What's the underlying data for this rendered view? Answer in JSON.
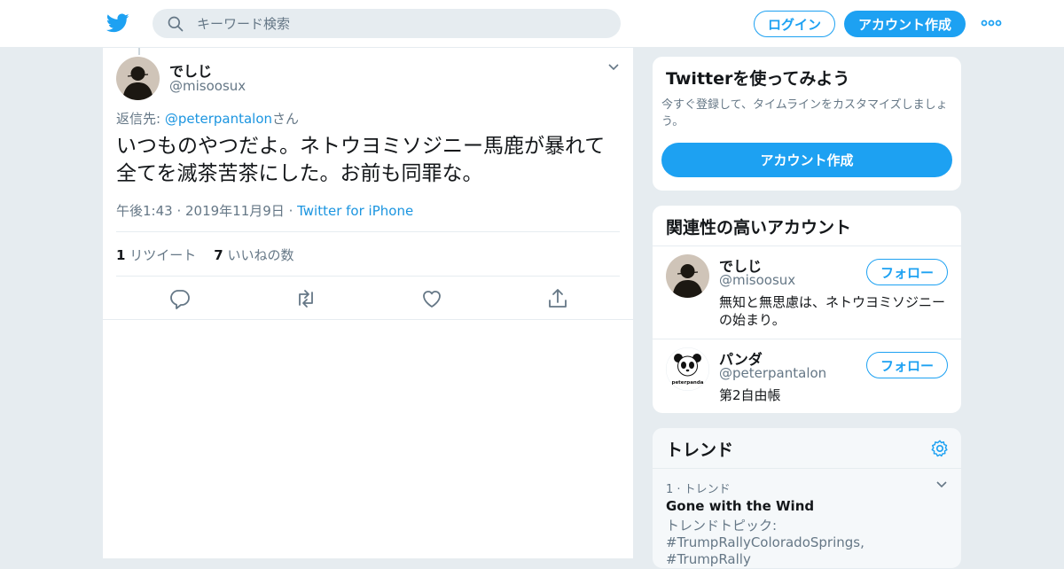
{
  "header": {
    "search_placeholder": "キーワード検索",
    "login_label": "ログイン",
    "signup_label": "アカウント作成",
    "brand_color": "#1da1f2"
  },
  "tweet": {
    "author_name": "でしじ",
    "author_handle": "@misoosux",
    "reply_prefix": "返信先: ",
    "reply_mention": "@peterpantalon",
    "reply_suffix": "さん",
    "text": "いつものやつだよ。ネトウヨミソジニー馬鹿が暴れて全てを滅茶苦茶にした。お前も同罪な。",
    "time": "午後1:43 · 2019年11月9日",
    "source_separator": " · ",
    "source": "Twitter for iPhone",
    "retweet_count": "1",
    "retweet_label": "リツイート",
    "like_count": "7",
    "like_label": "いいねの数"
  },
  "sidebar": {
    "signup_card": {
      "title": "Twitterを使ってみよう",
      "description": "今すぐ登録して、タイムラインをカスタマイズしましょう。",
      "button_label": "アカウント作成"
    },
    "related": {
      "title": "関連性の高いアカウント",
      "follow_label": "フォロー",
      "accounts": [
        {
          "name": "でしじ",
          "handle": "@misoosux",
          "bio": "無知と無思慮は、ネトウヨミソジニーの始まり。"
        },
        {
          "name": "パンダ",
          "handle": "@peterpantalon",
          "bio": "第2自由帳",
          "avatar_text": "peterpanda"
        }
      ]
    },
    "trends": {
      "title": "トレンド",
      "items": [
        {
          "rank": "1 · トレンド",
          "name": "Gone with the Wind",
          "description": "トレンドトピック: #TrumpRallyColoradoSprings, #TrumpRally"
        }
      ]
    }
  }
}
